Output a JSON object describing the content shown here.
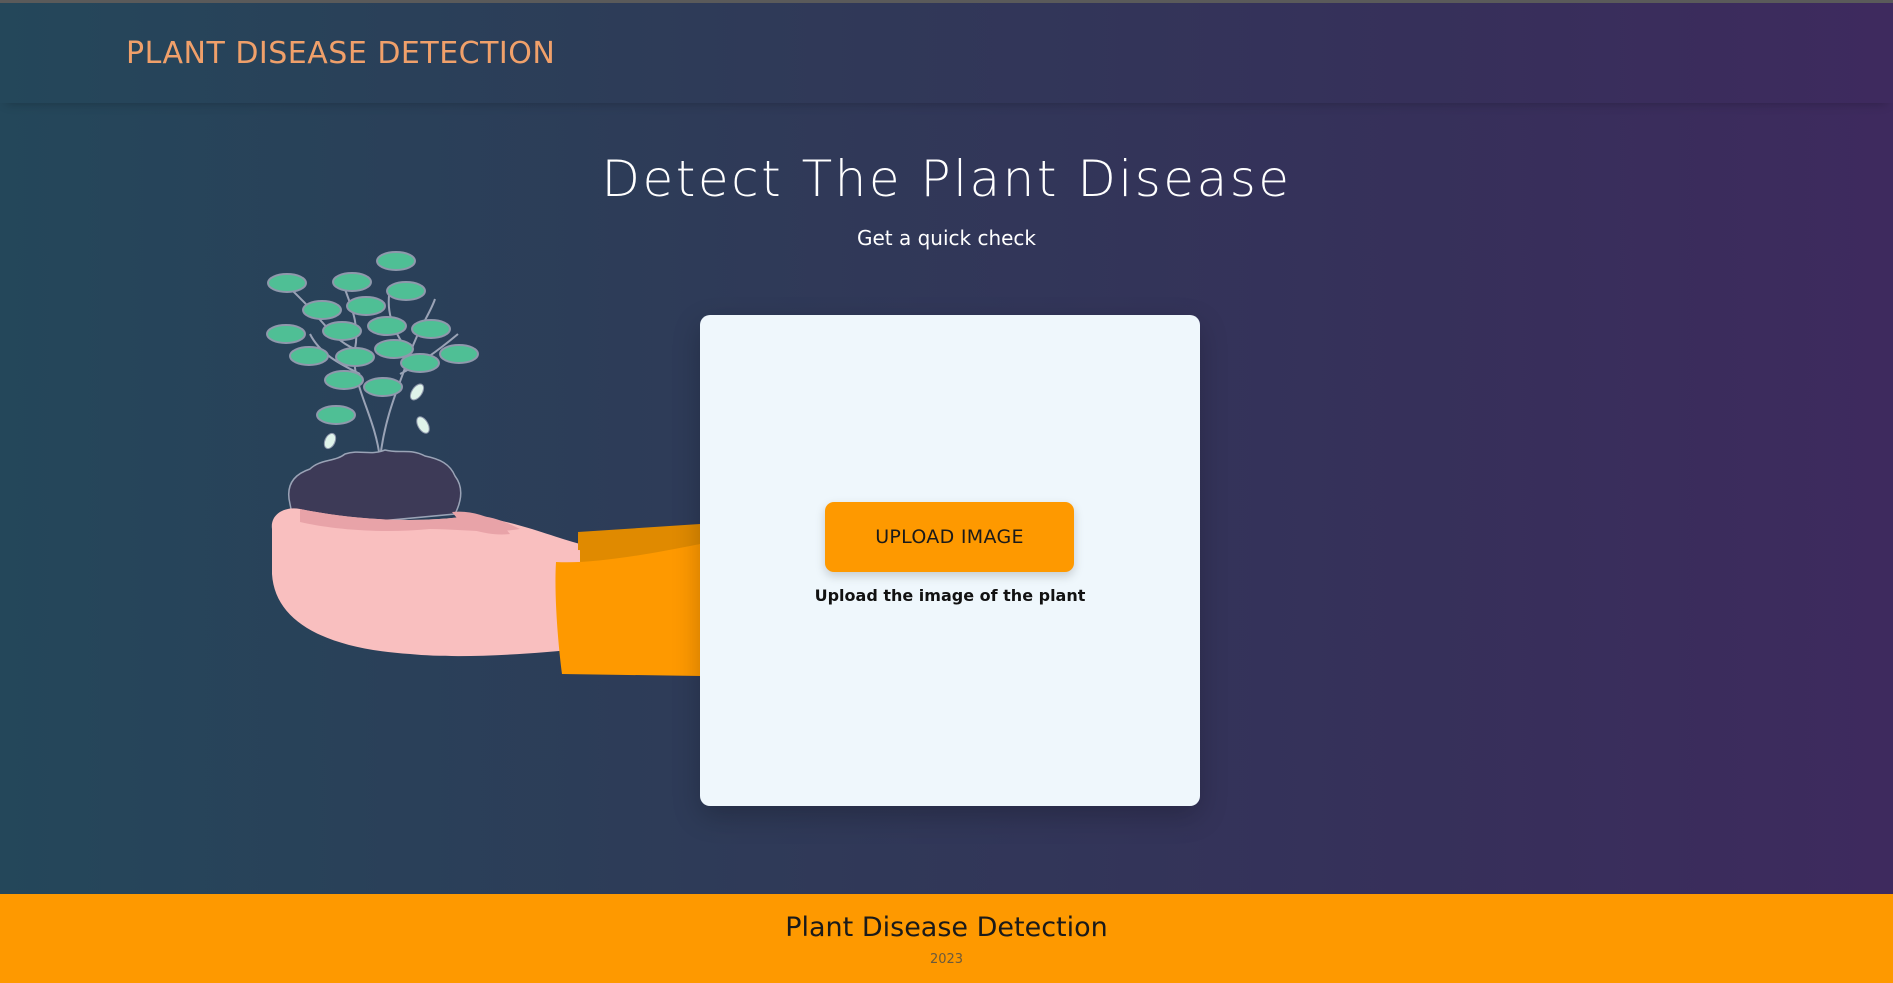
{
  "header": {
    "brand": "PLANT DISEASE DETECTION"
  },
  "hero": {
    "title": "Detect The Plant Disease",
    "subtitle": "Get a quick check"
  },
  "upload": {
    "button_label": "UPLOAD IMAGE",
    "hint": "Upload the image of the plant"
  },
  "footer": {
    "title": "Plant Disease Detection",
    "year": "2023"
  },
  "colors": {
    "accent_orange": "#fe9900",
    "brand_text": "#f0a06a",
    "card_background": "#eff7fc",
    "leaf_green": "#4fbf95",
    "hand_pink": "#f9bfbf",
    "soil": "#3d3a57"
  },
  "illustration": {
    "subject": "hand-holding-plant-icon"
  }
}
